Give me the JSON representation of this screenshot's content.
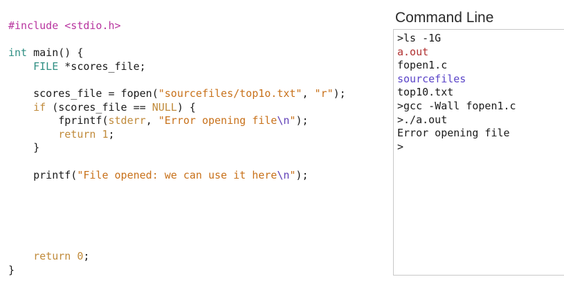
{
  "editor": {
    "lines": [
      [
        {
          "t": "#include <stdio.h>",
          "c": "pre"
        }
      ],
      [],
      [
        {
          "t": "int",
          "c": "type"
        },
        {
          "t": " main() {",
          "c": "txt"
        }
      ],
      [
        {
          "t": "    ",
          "c": "txt"
        },
        {
          "t": "FILE",
          "c": "type"
        },
        {
          "t": " *scores_file;",
          "c": "txt"
        }
      ],
      [],
      [
        {
          "t": "    scores_file = fopen(",
          "c": "txt"
        },
        {
          "t": "\"sourcefiles/top1o.txt\"",
          "c": "str"
        },
        {
          "t": ", ",
          "c": "txt"
        },
        {
          "t": "\"r\"",
          "c": "str"
        },
        {
          "t": ");",
          "c": "txt"
        }
      ],
      [
        {
          "t": "    ",
          "c": "txt"
        },
        {
          "t": "if",
          "c": "kw"
        },
        {
          "t": " (scores_file == ",
          "c": "txt"
        },
        {
          "t": "NULL",
          "c": "kw"
        },
        {
          "t": ") {",
          "c": "txt"
        }
      ],
      [
        {
          "t": "        fprintf(",
          "c": "txt"
        },
        {
          "t": "stderr",
          "c": "kw"
        },
        {
          "t": ", ",
          "c": "txt"
        },
        {
          "t": "\"Error opening file",
          "c": "str"
        },
        {
          "t": "\\n",
          "c": "esc"
        },
        {
          "t": "\"",
          "c": "str"
        },
        {
          "t": ");",
          "c": "txt"
        }
      ],
      [
        {
          "t": "        ",
          "c": "txt"
        },
        {
          "t": "return",
          "c": "kw"
        },
        {
          "t": " ",
          "c": "txt"
        },
        {
          "t": "1",
          "c": "kw"
        },
        {
          "t": ";",
          "c": "txt"
        }
      ],
      [
        {
          "t": "    }",
          "c": "txt"
        }
      ],
      [],
      [
        {
          "t": "    printf(",
          "c": "txt"
        },
        {
          "t": "\"File opened: we can use it here",
          "c": "str"
        },
        {
          "t": "\\n",
          "c": "esc"
        },
        {
          "t": "\"",
          "c": "str"
        },
        {
          "t": ");",
          "c": "txt"
        }
      ],
      [],
      [],
      [],
      [],
      [],
      [
        {
          "t": "    ",
          "c": "txt"
        },
        {
          "t": "return",
          "c": "kw"
        },
        {
          "t": " ",
          "c": "txt"
        },
        {
          "t": "0",
          "c": "kw"
        },
        {
          "t": ";",
          "c": "txt"
        }
      ],
      [
        {
          "t": "}",
          "c": "txt"
        }
      ]
    ]
  },
  "terminal": {
    "title": "Command Line",
    "lines": [
      {
        "text": ">ls -1G",
        "color": "#1a1a1a"
      },
      {
        "text": "a.out",
        "color": "#b03030"
      },
      {
        "text": "fopen1.c",
        "color": "#1a1a1a"
      },
      {
        "text": "sourcefiles",
        "color": "#5a44c8"
      },
      {
        "text": "top10.txt",
        "color": "#1a1a1a"
      },
      {
        "text": ">gcc -Wall fopen1.c",
        "color": "#1a1a1a"
      },
      {
        "text": ">./a.out",
        "color": "#1a1a1a"
      },
      {
        "text": "Error opening file",
        "color": "#1a1a1a"
      },
      {
        "text": ">",
        "color": "#1a1a1a"
      }
    ]
  }
}
